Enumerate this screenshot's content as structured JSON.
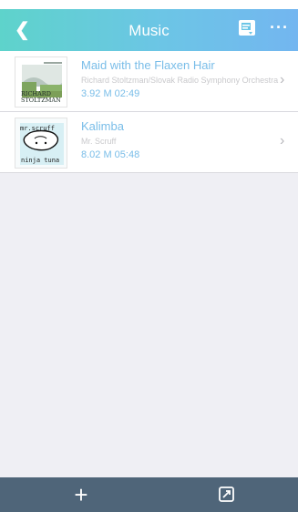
{
  "header": {
    "back_glyph": "❮",
    "title": "Music",
    "more_glyph": "···"
  },
  "tracks": [
    {
      "title": "Maid with the Flaxen Hair",
      "artist": "Richard Stoltzman/Slovak Radio Symphony Orchestra",
      "meta": "3.92 M 02:49",
      "cover_lines": [
        "RICHARD",
        "STOLTZMAN"
      ]
    },
    {
      "title": "Kalimba",
      "artist": "Mr. Scruff",
      "meta": "8.02 M 05:48",
      "cover_lines": [
        "mr.scruff",
        "ninja tuna"
      ]
    }
  ],
  "footer": {
    "add_glyph": "+"
  },
  "colors": {
    "header_start": "#5ed3cb",
    "header_end": "#73b6f0",
    "accent_text": "#79bde8",
    "footer_bg": "#4f6579"
  },
  "icons": {
    "back": "back-chevron-icon",
    "document": "document-icon",
    "more": "more-dots-icon",
    "chevron": "chevron-right-icon",
    "add": "plus-icon",
    "share": "share-icon"
  }
}
